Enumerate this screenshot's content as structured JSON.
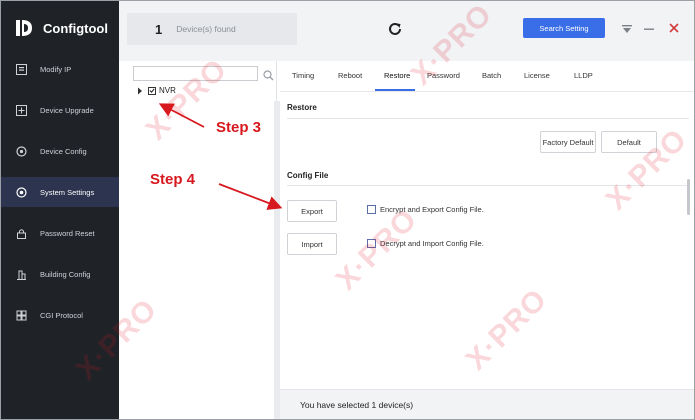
{
  "app": {
    "title": "Configtool"
  },
  "sidebar": {
    "items": [
      {
        "label": "Modify IP",
        "icon": "modify-ip-icon",
        "active": false
      },
      {
        "label": "Device Upgrade",
        "icon": "upgrade-icon",
        "active": false
      },
      {
        "label": "Device Config",
        "icon": "config-icon",
        "active": false
      },
      {
        "label": "System Settings",
        "icon": "settings-icon",
        "active": true
      },
      {
        "label": "Password Reset",
        "icon": "lock-icon",
        "active": false
      },
      {
        "label": "Building Config",
        "icon": "building-icon",
        "active": false
      },
      {
        "label": "CGI Protocol",
        "icon": "grid-icon",
        "active": false
      }
    ]
  },
  "topbar": {
    "count": "1",
    "found_label": "Device(s) found",
    "search_setting_label": "Search Setting"
  },
  "tree": {
    "search_placeholder": "",
    "node_label": "NVR"
  },
  "tabs": [
    "Timing",
    "Reboot",
    "Restore",
    "Password",
    "Batch",
    "License",
    "LLDP"
  ],
  "active_tab": "Restore",
  "restore": {
    "title": "Restore",
    "factory_default_label": "Factory Default",
    "default_label": "Default"
  },
  "config_file": {
    "title": "Config File",
    "export_label": "Export",
    "export_option": "Encrypt and Export Config File.",
    "import_label": "Import",
    "import_option": "Decrypt and Import Config File."
  },
  "footer": {
    "text": "You have selected 1 device(s)"
  },
  "annotations": {
    "step3": "Step 3",
    "step4": "Step 4"
  },
  "colors": {
    "accent": "#3a6ee8",
    "sidebar_bg": "#1f2328",
    "annotation": "#d7191f",
    "close": "#d23b3b"
  }
}
